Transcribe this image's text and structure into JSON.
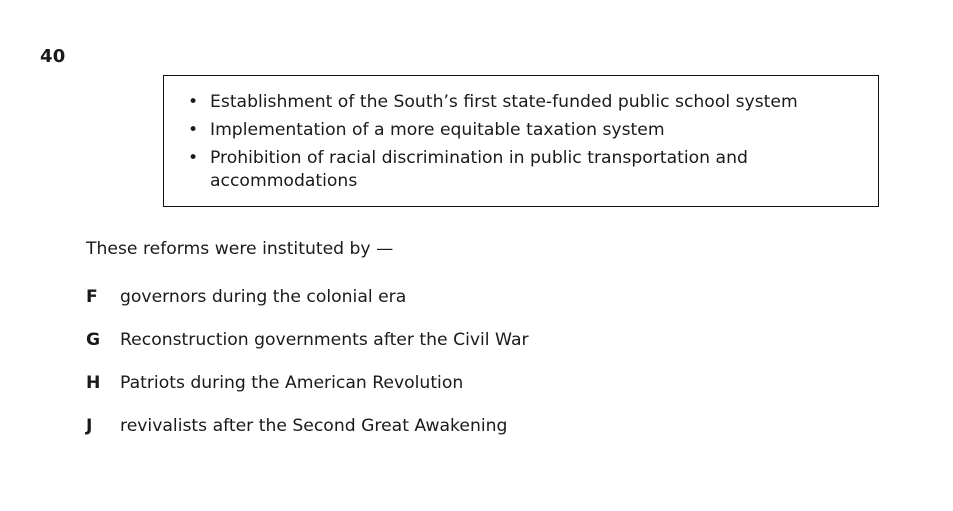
{
  "question": {
    "number": "40",
    "stimulus_bullets": [
      "Establishment of the South’s first state-funded public school system",
      "Implementation of a more equitable taxation system",
      "Prohibition of racial discrimination in public transportation and accommodations"
    ],
    "bullet_glyph": "•",
    "stem": "These reforms were instituted by —",
    "options": [
      {
        "letter": "F",
        "text": "governors during the colonial era"
      },
      {
        "letter": "G",
        "text": "Reconstruction governments after the Civil War"
      },
      {
        "letter": "H",
        "text": "Patriots during the American Revolution"
      },
      {
        "letter": "J",
        "text": "revivalists after the Second Great Awakening"
      }
    ]
  }
}
